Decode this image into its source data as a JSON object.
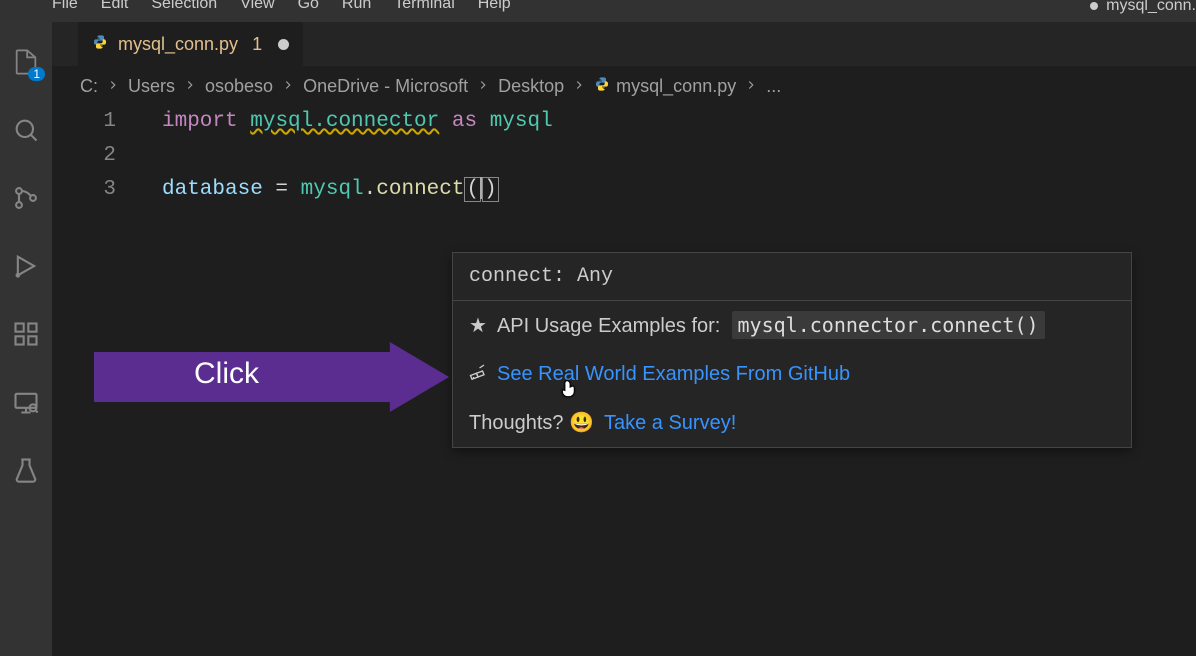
{
  "menu": {
    "items": [
      "File",
      "Edit",
      "Selection",
      "View",
      "Go",
      "Run",
      "Terminal",
      "Help"
    ]
  },
  "titlebar": {
    "filename": "mysql_conn."
  },
  "activity": {
    "explorer_badge": "1"
  },
  "tab": {
    "name": "mysql_conn.py",
    "suffix": "1"
  },
  "breadcrumbs": {
    "items": [
      "C:",
      "Users",
      "osobeso",
      "OneDrive - Microsoft",
      "Desktop",
      "mysql_conn.py",
      "..."
    ]
  },
  "code": {
    "lines": [
      {
        "n": "1",
        "tokens": {
          "import": "import",
          "mysql_connector": "mysql.connector",
          "as": "as",
          "alias": "mysql"
        }
      },
      {
        "n": "2"
      },
      {
        "n": "3",
        "tokens": {
          "var": "database",
          "eq": " = ",
          "mod": "mysql",
          "dot": ".",
          "fn": "connect"
        }
      }
    ]
  },
  "hover": {
    "signature": "connect: Any",
    "api_label": "API Usage Examples for:",
    "api_code": "mysql.connector.connect()",
    "link1": "See Real World Examples From GitHub",
    "thoughts": "Thoughts?",
    "link2": "Take a Survey!"
  },
  "annotation": {
    "label": "Click"
  }
}
